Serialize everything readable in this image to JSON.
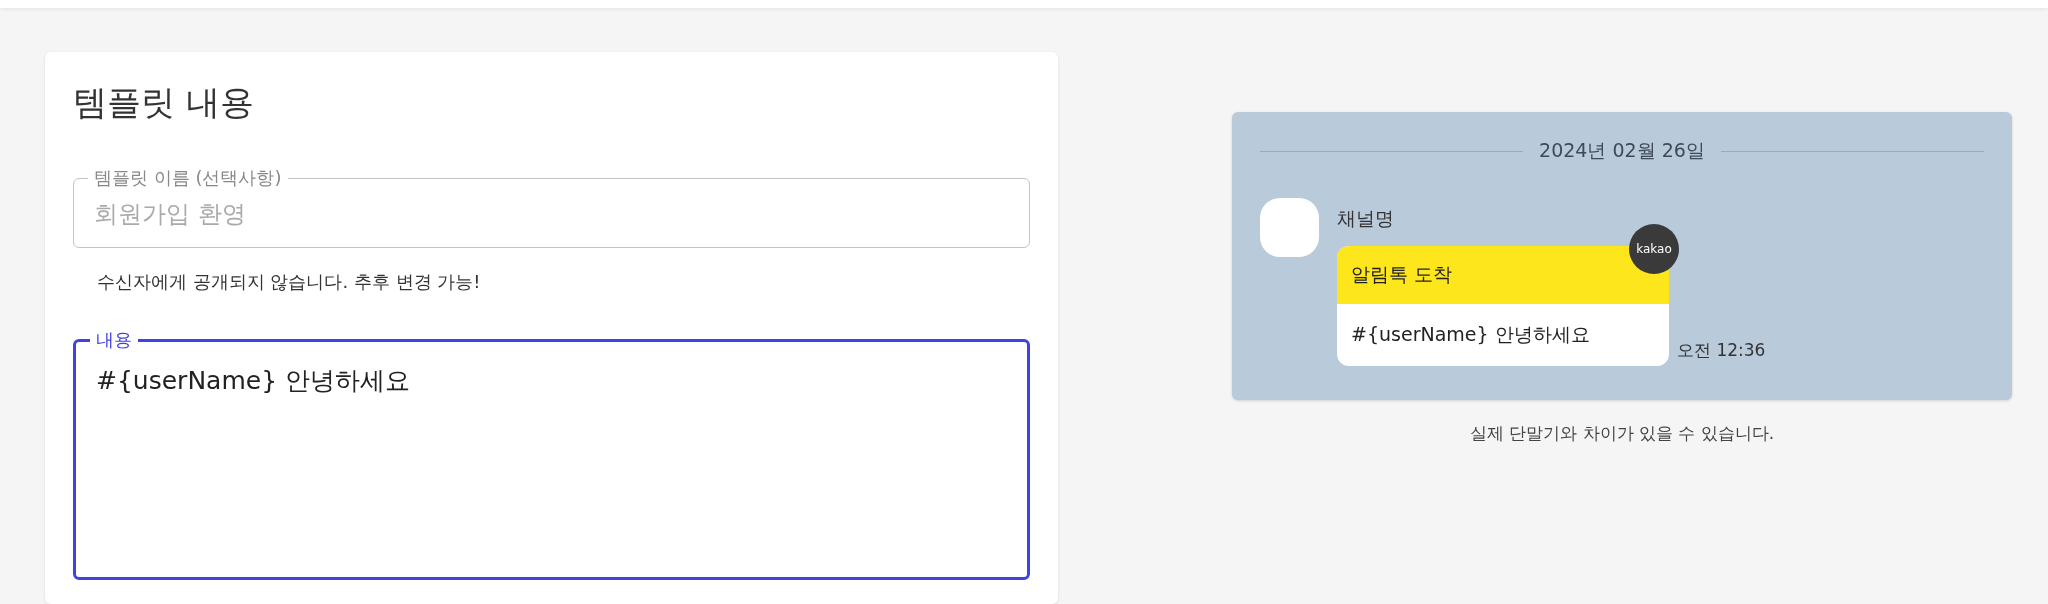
{
  "editor": {
    "title": "템플릿 내용",
    "fields": [
      {
        "label": "템플릿 이름 (선택사항)",
        "placeholder": "회원가입 환영",
        "helper": "수신자에게 공개되지 않습니다. 추후 변경 가능!",
        "focused": false,
        "kind": "input"
      },
      {
        "label": "내용",
        "value": "#{userName} 안녕하세요",
        "focused": true,
        "kind": "textarea"
      }
    ]
  },
  "preview": {
    "date": "2024년 02월 26일",
    "channel": "채널명",
    "badge": "kakao",
    "header": "알림톡 도착",
    "message": "#{userName} 안녕하세요",
    "time": "오전 12:36",
    "note": "실제 단말기와 차이가 있을 수 있습니다."
  }
}
